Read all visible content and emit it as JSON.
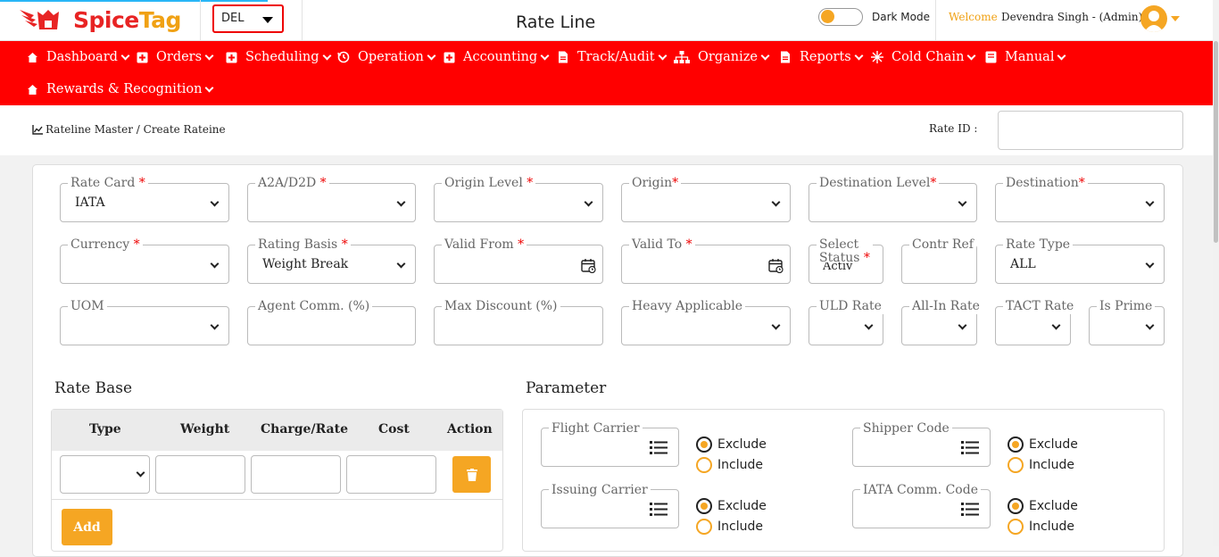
{
  "header": {
    "logo_text_a": "Spice",
    "logo_text_b": "Tag",
    "station": "DEL",
    "page_title": "Rate Line",
    "dark_mode_label": "Dark Mode",
    "welcome_label": "Welcome",
    "user_name": "Devendra Singh - (Admin)"
  },
  "nav": [
    {
      "label": "Dashboard",
      "icon": "home-icon"
    },
    {
      "label": "Orders",
      "icon": "plus-square-icon"
    },
    {
      "label": "Scheduling",
      "icon": "plus-square-icon"
    },
    {
      "label": "Operation",
      "icon": "history-icon"
    },
    {
      "label": "Accounting",
      "icon": "plus-square-icon"
    },
    {
      "label": "Track/Audit",
      "icon": "file-icon"
    },
    {
      "label": "Organize",
      "icon": "sitemap-icon"
    },
    {
      "label": "Reports",
      "icon": "file-icon"
    },
    {
      "label": "Cold Chain",
      "icon": "snowflake-icon"
    },
    {
      "label": "Manual",
      "icon": "book-icon"
    },
    {
      "label": "Rewards & Recognition",
      "icon": "home-icon"
    }
  ],
  "breadcrumb": {
    "text": "Rateline Master / Create Rateine",
    "rate_id_label": "Rate ID :",
    "rate_id_value": ""
  },
  "form": {
    "rate_card": {
      "label": "Rate Card ",
      "req": "*",
      "value": "IATA"
    },
    "a2a": {
      "label": "A2A/D2D ",
      "req": "*",
      "value": ""
    },
    "origin_level": {
      "label": "Origin Level ",
      "req": "*",
      "value": ""
    },
    "origin": {
      "label": "Origin",
      "req": "*",
      "value": ""
    },
    "destination_level": {
      "label": "Destination Level",
      "req": "*",
      "value": ""
    },
    "destination": {
      "label": "Destination",
      "req": "*",
      "value": ""
    },
    "currency": {
      "label": "Currency ",
      "req": "*",
      "value": ""
    },
    "rating_basis": {
      "label": "Rating Basis ",
      "req": "*",
      "value": "Weight Break"
    },
    "valid_from": {
      "label": "Valid From ",
      "req": "*",
      "value": ""
    },
    "valid_to": {
      "label": "Valid To ",
      "req": "*",
      "value": ""
    },
    "status": {
      "label_line1": "Select",
      "label_line2": "Status ",
      "req": "*",
      "value": "Activ"
    },
    "contr_ref": {
      "label": "Contr Ref",
      "value": ""
    },
    "rate_type": {
      "label": "Rate Type",
      "value": "ALL"
    },
    "uom": {
      "label": "UOM",
      "value": ""
    },
    "agent_comm": {
      "label": "Agent Comm. (%)",
      "value": ""
    },
    "max_discount": {
      "label": "Max Discount (%)",
      "value": ""
    },
    "heavy_applicable": {
      "label": "Heavy Applicable",
      "value": ""
    },
    "uld_rate": {
      "label": "ULD Rate",
      "value": ""
    },
    "all_in_rate": {
      "label": "All-In Rate",
      "value": ""
    },
    "tact_rate": {
      "label": "TACT Rate",
      "value": ""
    },
    "is_prime": {
      "label": "Is Prime",
      "value": ""
    }
  },
  "rate_base": {
    "title": "Rate Base",
    "columns": [
      "Type",
      "Weight",
      "Charge/Rate",
      "Cost",
      "Action"
    ],
    "add_label": "Add"
  },
  "parameter": {
    "title": "Parameter",
    "fields": [
      {
        "label": "Flight Carrier",
        "selected": "Exclude"
      },
      {
        "label": "Shipper Code",
        "selected": "Exclude"
      },
      {
        "label": "Issuing Carrier",
        "selected": "Exclude"
      },
      {
        "label": "IATA Comm. Code",
        "selected": "Exclude"
      }
    ],
    "exclude_label": "Exclude",
    "include_label": "Include"
  },
  "colors": {
    "primary_red": "#ff0000",
    "accent_orange": "#f5a623"
  }
}
